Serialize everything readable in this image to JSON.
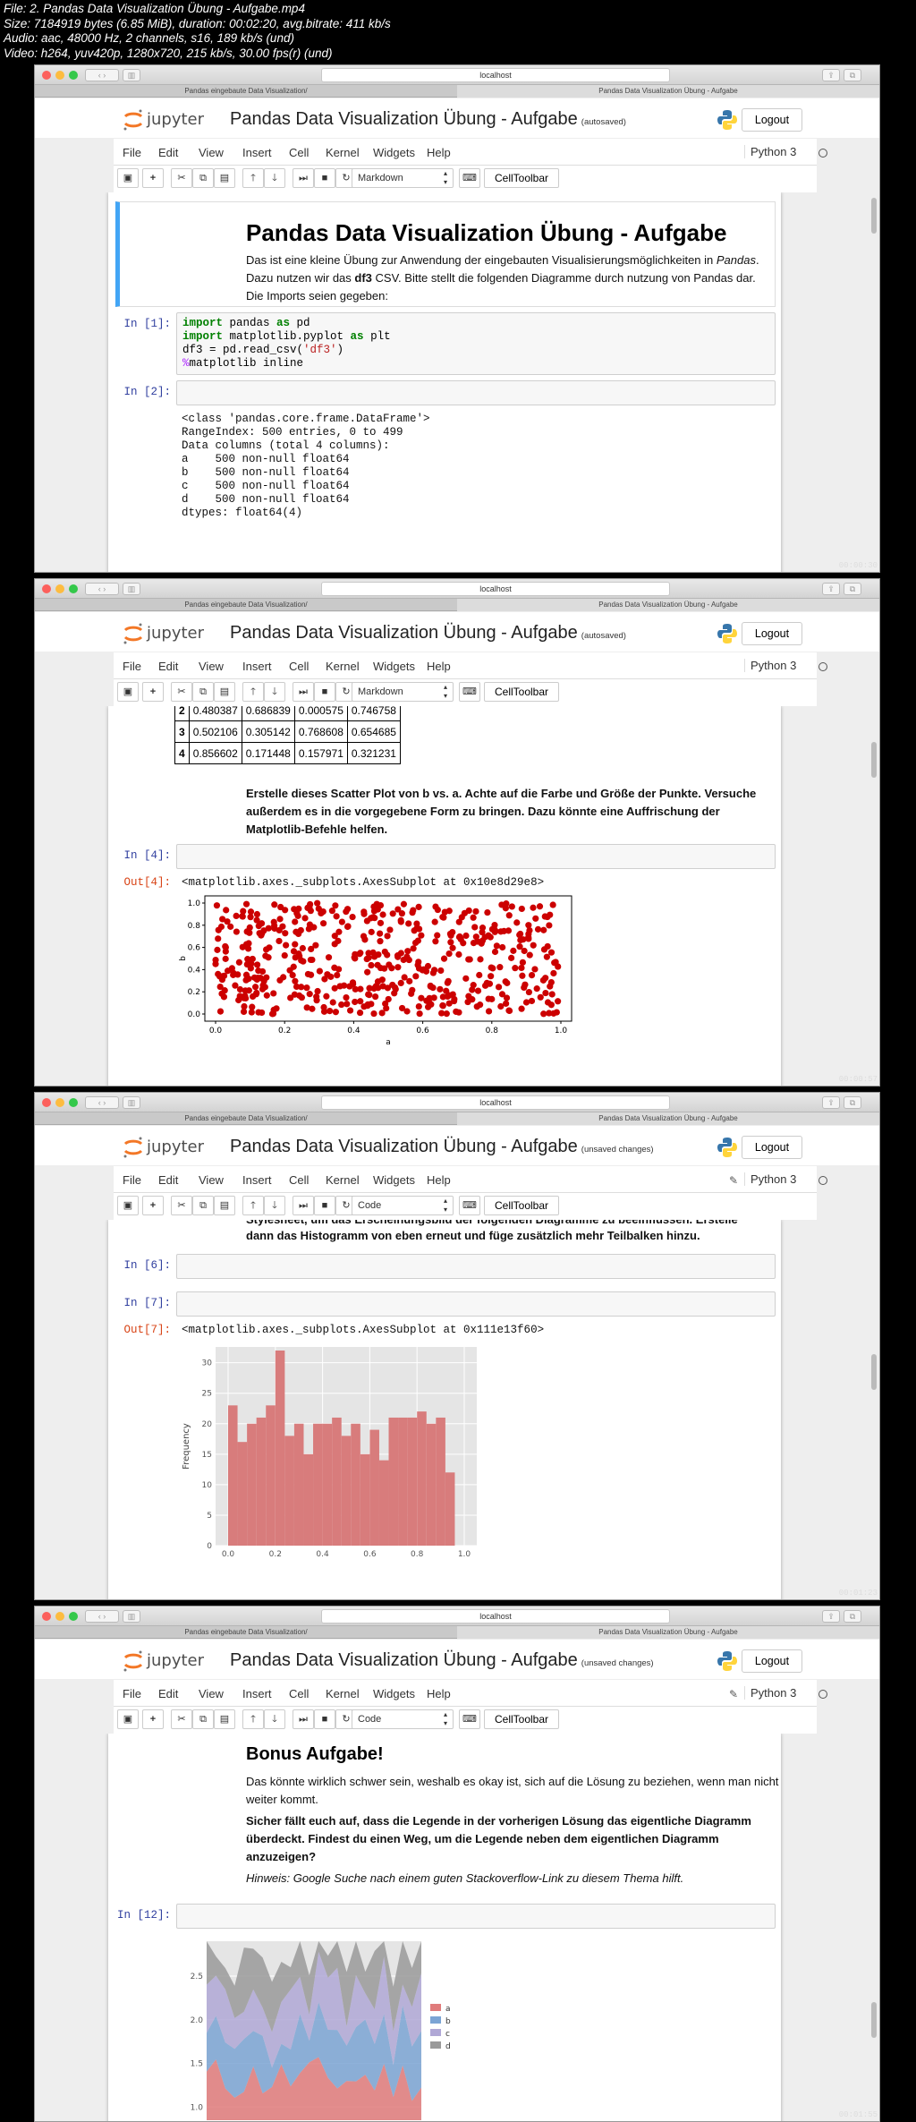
{
  "file_info": {
    "line1": "File: 2. Pandas Data Visualization Übung - Aufgabe.mp4",
    "line2": "Size: 7184919 bytes (6.85 MiB), duration: 00:02:20, avg.bitrate: 411 kb/s",
    "line3": "Audio: aac, 48000 Hz, 2 channels, s16, 189 kb/s (und)",
    "line4": "Video: h264, yuv420p, 1280x720, 215 kb/s, 30.00 fps(r) (und)"
  },
  "browser": {
    "url": "localhost",
    "tab_left": "Pandas eingebaute Data Visualization/",
    "tab_right": "Pandas Data Visualization Übung - Aufgabe"
  },
  "jupyter": {
    "logo_text": "jupyter",
    "title": "Pandas Data Visualization Übung - Aufgabe",
    "logout": "Logout",
    "kernel": "Python 3",
    "menu": [
      "File",
      "Edit",
      "View",
      "Insert",
      "Cell",
      "Kernel",
      "Widgets",
      "Help"
    ],
    "celltoolbar": "CellToolbar",
    "accent": "#f37726"
  },
  "frames": [
    {
      "status": "(autosaved)",
      "celltype": "Markdown",
      "timestamp": "00:00:30",
      "heading": "Pandas Data Visualization Übung - Aufgabe",
      "intro_1": "Das ist eine kleine Übung zur Anwendung der eingebauten Visualisierungsmöglichkeiten in ",
      "intro_em": "Pandas",
      "intro_2": ". Dazu nutzen wir das ",
      "intro_bold": "df3",
      "intro_3": " CSV. Bitte stellt die folgenden Diagramme durch nutzung von Pandas dar. Die Imports seien gegeben:",
      "prompt1": "In [1]:",
      "prompt2": "In [2]:",
      "code": {
        "l1_kw": "import",
        "l1_rest": " pandas ",
        "l1_as": "as",
        "l1_alias": " pd",
        "l2_kw": "import",
        "l2_rest": " matplotlib.pyplot ",
        "l2_as": "as",
        "l2_alias": " plt",
        "l3_a": "df3 = pd.read_csv(",
        "l3_str": "'df3'",
        "l3_b": ")",
        "l4_mg": "%",
        "l4_rest": "matplotlib inline"
      },
      "output": [
        "<class 'pandas.core.frame.DataFrame'>",
        "RangeIndex: 500 entries, 0 to 499",
        "Data columns (total 4 columns):",
        "a    500 non-null float64",
        "b    500 non-null float64",
        "c    500 non-null float64",
        "d    500 non-null float64",
        "dtypes: float64(4)"
      ]
    },
    {
      "status": "(autosaved)",
      "celltype": "Markdown",
      "timestamp": "00:00:57",
      "table": [
        [
          "2",
          "0.480387",
          "0.686839",
          "0.000575",
          "0.746758"
        ],
        [
          "3",
          "0.502106",
          "0.305142",
          "0.768608",
          "0.654685"
        ],
        [
          "4",
          "0.856602",
          "0.171448",
          "0.157971",
          "0.321231"
        ]
      ],
      "task": "Erstelle dieses Scatter Plot von b vs. a. Achte auf die Farbe und Größe der Punkte. Versuche außerdem es in die vorgegebene Form zu bringen. Dazu könnte eine Auffrischung der Matplotlib-Befehle helfen.",
      "prompt_in": "In [4]:",
      "prompt_out": "Out[4]:",
      "out_text": "<matplotlib.axes._subplots.AxesSubplot at 0x10e8d29e8>"
    },
    {
      "status": "(unsaved changes)",
      "celltype": "Code",
      "timestamp": "00:01:23",
      "task_top": "Stylesheet, um das Erscheinungsbild der folgenden Diagramme zu beeinflussen. Erstelle",
      "task_bottom": "dann das Histogramm von eben erneut und füge zusätzlich mehr Teilbalken hinzu.",
      "prompt6": "In [6]:",
      "prompt7": "In [7]:",
      "prompt_out": "Out[7]:",
      "out_text": "<matplotlib.axes._subplots.AxesSubplot at 0x111e13f60>"
    },
    {
      "status": "(unsaved changes)",
      "celltype": "Code",
      "timestamp": "00:01:55",
      "heading": "Bonus Aufgabe!",
      "p1": "Das könnte wirklich schwer sein, weshalb es okay ist, sich auf die Lösung zu beziehen, wenn man nicht weiter kommt.",
      "p2": "Sicher fällt euch auf, dass die Legende in der vorherigen Lösung das eigentliche Diagramm überdeckt. Findest du einen Weg, um die Legende neben dem eigentlichen Diagramm anzuzeigen?",
      "p3": "Hinweis: Google Suche nach einem guten Stackoverflow-Link zu diesem Thema hilft.",
      "prompt": "In [12]:"
    }
  ],
  "chart_data": [
    {
      "type": "scatter",
      "xlabel": "a",
      "ylabel": "b",
      "xlim": [
        0,
        1
      ],
      "ylim": [
        0,
        1
      ],
      "xticks": [
        "0.0",
        "0.2",
        "0.4",
        "0.6",
        "0.8",
        "1.0"
      ],
      "yticks": [
        "0.0",
        "0.2",
        "0.4",
        "0.6",
        "0.8",
        "1.0"
      ],
      "color": "#cc0000",
      "n_points": 500
    },
    {
      "type": "bar",
      "xlabel": "",
      "ylabel": "Frequency",
      "ylim": [
        0,
        32
      ],
      "xticks": [
        "0.0",
        "0.2",
        "0.4",
        "0.6",
        "0.8",
        "1.0"
      ],
      "yticks": [
        "0",
        "5",
        "10",
        "15",
        "20",
        "25",
        "30"
      ],
      "bins": [
        0,
        0.04,
        0.08,
        0.12,
        0.16,
        0.2,
        0.24,
        0.28,
        0.32,
        0.36,
        0.4,
        0.44,
        0.48,
        0.52,
        0.56,
        0.6,
        0.64,
        0.68,
        0.72,
        0.76,
        0.8,
        0.84,
        0.88,
        0.92,
        0.96,
        1.0
      ],
      "values": [
        23,
        17,
        20,
        21,
        23,
        32,
        18,
        20,
        15,
        20,
        20,
        21,
        18,
        20,
        15,
        19,
        14,
        21,
        21,
        21,
        22,
        20,
        21,
        12,
        0
      ],
      "color": "#d87c7c"
    },
    {
      "type": "area",
      "xlabel": "",
      "ylabel": "",
      "yticks": [
        "1.0",
        "1.5",
        "2.0",
        "2.5"
      ],
      "series": [
        {
          "name": "a",
          "color": "#e07b7b"
        },
        {
          "name": "b",
          "color": "#7ba4d4"
        },
        {
          "name": "c",
          "color": "#b0a8d6"
        },
        {
          "name": "d",
          "color": "#9a9a9a"
        }
      ]
    }
  ]
}
